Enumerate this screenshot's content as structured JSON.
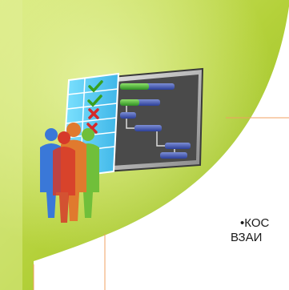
{
  "slide": {
    "text_line_1": "•КОС",
    "text_line_2": "ВЗАИ"
  },
  "icons": {
    "illustration": "gantt-chart-with-people-icon"
  },
  "colors": {
    "background_green_light": "#cfe36b",
    "background_green_dark": "#8fb71e",
    "accent_orange": "#f0a060",
    "check_green": "#37a020",
    "cross_red": "#d52a2a"
  }
}
